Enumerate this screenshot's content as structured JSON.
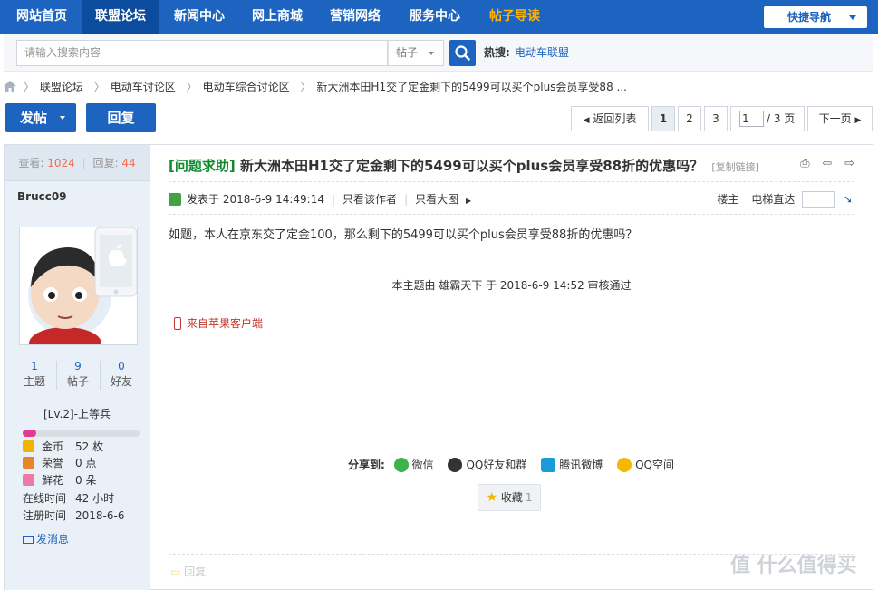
{
  "nav": {
    "items": [
      "网站首页",
      "联盟论坛",
      "新闻中心",
      "网上商城",
      "营销网络",
      "服务中心",
      "帖子导读"
    ],
    "quick_nav": "快捷导航"
  },
  "search": {
    "placeholder": "请输入搜索内容",
    "category": "帖子",
    "hot_label": "热搜:",
    "hot_link": "电动车联盟"
  },
  "breadcrumb": [
    "联盟论坛",
    "电动车讨论区",
    "电动车综合讨论区",
    "新大洲本田H1交了定金剩下的5499可以买个plus会员享受88 ..."
  ],
  "actions": {
    "post": "发帖",
    "reply": "回复"
  },
  "pagination": {
    "back": "返回列表",
    "pages": [
      "1",
      "2",
      "3"
    ],
    "input_value": "1",
    "total": "/ 3 页",
    "next": "下一页"
  },
  "sidebar": {
    "view_label": "查看:",
    "views": "1024",
    "reply_label": "回复:",
    "replies": "44",
    "author": "Brucc09",
    "stats": [
      {
        "value": "1",
        "label": "主题"
      },
      {
        "value": "9",
        "label": "帖子"
      },
      {
        "value": "0",
        "label": "好友"
      }
    ],
    "level": "[Lv.2]-上等兵",
    "level_progress": 0.12,
    "info": [
      {
        "key": "金币",
        "value": "52 枚",
        "color": "#f0b400"
      },
      {
        "key": "荣誉",
        "value": "0 点",
        "color": "#e8852a"
      },
      {
        "key": "鲜花",
        "value": "0 朵",
        "color": "#f07aa6"
      },
      {
        "key": "在线时间",
        "value": "42 小时"
      },
      {
        "key": "注册时间",
        "value": "2018-6-6"
      }
    ],
    "send_msg": "发消息"
  },
  "post": {
    "tag_open": "[",
    "tag": "问题求助",
    "tag_close": "]",
    "title": "新大洲本田H1交了定金剩下的5499可以买个plus会员享受88折的优惠吗？",
    "copy_link": "[复制链接]",
    "posted": "发表于 2018-6-9 14:49:14",
    "only_author": "只看该作者",
    "big_image": "只看大图",
    "floor": "楼主",
    "elevator": "电梯直达",
    "content": "如题，本人在京东交了定金100，那么剩下的5499可以买个plus会员享受88折的优惠吗？",
    "audit": "本主题由 雄霸天下 于 2018-6-9 14:52 审核通过",
    "client": "来自苹果客户端",
    "share_label": "分享到:",
    "share": [
      "微信",
      "QQ好友和群",
      "腾讯微博",
      "QQ空间"
    ],
    "fav": "收藏",
    "fav_count": "1",
    "reply_faint": "回复"
  },
  "watermark": "值 什么值得买"
}
